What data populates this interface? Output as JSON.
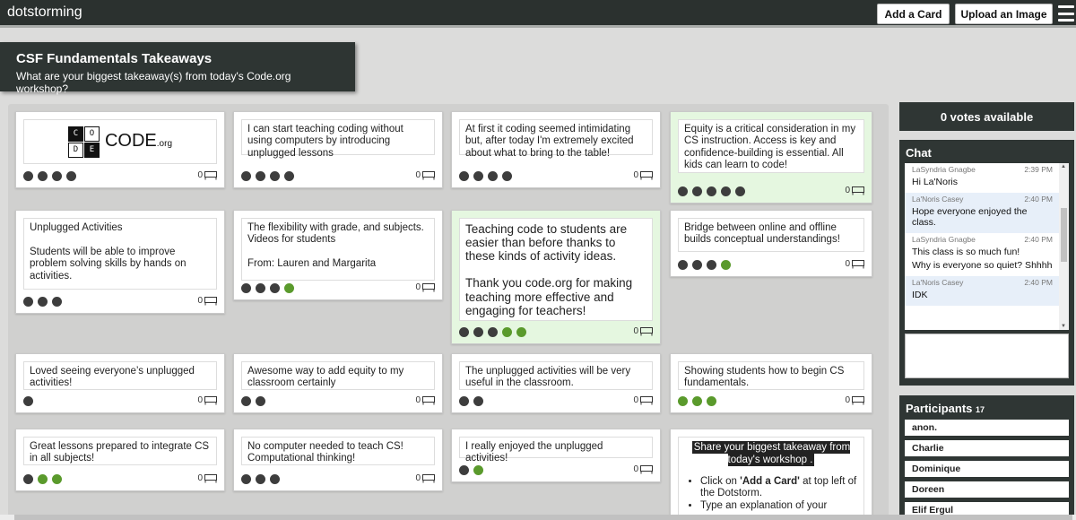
{
  "app": {
    "brand": "dotstorming"
  },
  "toolbar": {
    "add_card": "Add a Card",
    "upload_image": "Upload an Image"
  },
  "header": {
    "title": "CSF Fundamentals Takeaways",
    "subtitle": "What are your biggest takeaway(s) from today's Code.org workshop?"
  },
  "logo": {
    "letters": [
      "C",
      "O",
      "D",
      "E"
    ],
    "word": "CODE",
    "suffix": ".org"
  },
  "cards": [
    {
      "text": "",
      "votes": "0",
      "dots": [
        "d",
        "d",
        "d",
        "d"
      ]
    },
    {
      "text": "I can start teaching coding without using computers by introducing unplugged lessons",
      "votes": "0",
      "dots": [
        "d",
        "d",
        "d",
        "d"
      ]
    },
    {
      "text": "At first it coding seemed intimidating but, after today I'm extremely excited about what to bring to the table!",
      "votes": "0",
      "dots": [
        "d",
        "d",
        "d",
        "d"
      ]
    },
    {
      "text": "Equity is a critical consideration in my CS instruction. Access is key and confidence-building is essential. All kids can learn to code!",
      "votes": "0",
      "dots": [
        "d",
        "d",
        "d",
        "d",
        "d"
      ]
    },
    {
      "text": "Unplugged Activities\n\n Students will be able to improve problem solving skills by hands on activities.",
      "votes": "0",
      "dots": [
        "d",
        "d",
        "d"
      ]
    },
    {
      "text": "The flexibility with grade, and subjects. Videos for students\n\nFrom: Lauren and Margarita",
      "votes": "0",
      "dots": [
        "d",
        "d",
        "d",
        "g"
      ]
    },
    {
      "text": "Teaching code to students are easier than before thanks to these kinds of activity ideas.\n\nThank you code.org for making teaching more effective and engaging for teachers!",
      "votes": "0",
      "dots": [
        "d",
        "d",
        "d",
        "g",
        "g"
      ]
    },
    {
      "text": "Bridge between online and offline builds conceptual understandings!",
      "votes": "0",
      "dots": [
        "d",
        "d",
        "d",
        "g"
      ]
    },
    {
      "text": "Loved seeing everyone’s unplugged activities!",
      "votes": "0",
      "dots": [
        "d"
      ]
    },
    {
      "text": "Awesome way to add equity to my classroom certainly",
      "votes": "0",
      "dots": [
        "d",
        "d"
      ]
    },
    {
      "text": "The unplugged activities will be very useful in the classroom.",
      "votes": "0",
      "dots": [
        "d",
        "d"
      ]
    },
    {
      "text": "Showing students how to begin CS fundamentals.",
      "votes": "0",
      "dots": [
        "g",
        "g",
        "g"
      ]
    },
    {
      "text": "Great lessons prepared to integrate CS in all subjects!",
      "votes": "0",
      "dots": [
        "d",
        "g",
        "g"
      ]
    },
    {
      "text": "No computer needed to teach CS! Computational thinking!",
      "votes": "0",
      "dots": [
        "d",
        "d",
        "d"
      ]
    },
    {
      "text": "I really enjoyed the unplugged activities!",
      "votes": "0",
      "dots": [
        "d",
        "g"
      ]
    }
  ],
  "instructions": {
    "title": "Share your biggest takeaway from today's workshop .",
    "step1_pre": "Click on ",
    "step1_bold": "'Add a Card'",
    "step1_post": " at top left of the Dotstorm.",
    "step2": "Type an explanation of your"
  },
  "sidebar": {
    "votes_available": "0 votes available",
    "chat_title": "Chat",
    "messages": [
      {
        "who": "LaSyndria Gnagbe",
        "time": "2:39 PM",
        "texts": [
          "Hi La'Noris"
        ],
        "highlight": false
      },
      {
        "who": "La'Noris Casey",
        "time": "2:40 PM",
        "texts": [
          "Hope everyone enjoyed the class."
        ],
        "highlight": true
      },
      {
        "who": "LaSyndria Gnagbe",
        "time": "2:40 PM",
        "texts": [
          "This class is so much fun!",
          "Why is everyone so quiet? Shhhh"
        ],
        "highlight": false
      },
      {
        "who": "La'Noris Casey",
        "time": "2:40 PM",
        "texts": [
          "IDK"
        ],
        "highlight": true
      }
    ],
    "participants_title": "Participants",
    "participants_count": "17",
    "participants": [
      "anon.",
      "Charlie",
      "Dominique",
      "Doreen",
      "Elif Ergul"
    ]
  },
  "colors": {
    "topbar": "#2b312f",
    "panel": "#2f3634",
    "dot_dark": "#3d3d3d",
    "dot_green": "#5a9a2c",
    "card_green": "#e5f7e0"
  }
}
